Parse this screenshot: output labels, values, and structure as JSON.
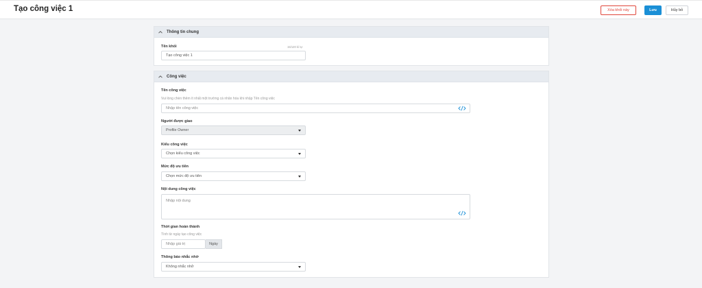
{
  "header": {
    "title": "Tạo công việc 1",
    "delete_label": "Xóa khối này",
    "save_label": "Lưu",
    "cancel_label": "Hủy bỏ"
  },
  "general": {
    "section_title": "Thông tin chung",
    "name_label": "Tên khối",
    "name_counter": "15/120 kí tự",
    "name_value": "Tạo công việc 1"
  },
  "task": {
    "section_title": "Công việc",
    "task_name_label": "Tên công việc",
    "task_name_hint": "Vui lòng chèn thêm ít nhất một trường cá nhân hóa khi nhập Tên công việc",
    "task_name_placeholder": "Nhập tên công việc",
    "assignee_label": "Người được giao",
    "assignee_value": "Profile Owner",
    "type_label": "Kiểu công việc",
    "type_placeholder": "Chọn kiểu công việc",
    "priority_label": "Mức độ ưu tiên",
    "priority_placeholder": "Chọn mức độ ưu tiên",
    "content_label": "Nội dung công việc",
    "content_placeholder": "Nhập nội dung",
    "deadline_label": "Thời gian hoàn thành",
    "deadline_hint": "Tính từ ngày tạo công việc",
    "deadline_placeholder": "Nhập giá trị",
    "deadline_unit": "Ngày",
    "reminder_label": "Thông báo nhắc nhở",
    "reminder_value": "Không nhắc nhở"
  },
  "colors": {
    "accent": "#1a8fd6",
    "danger": "#e0453a",
    "section_header": "#e7ebf0"
  },
  "icons": {
    "collapse": "chevron-up-icon",
    "personalize": "code-icon",
    "dropdown": "caret-down-icon"
  }
}
